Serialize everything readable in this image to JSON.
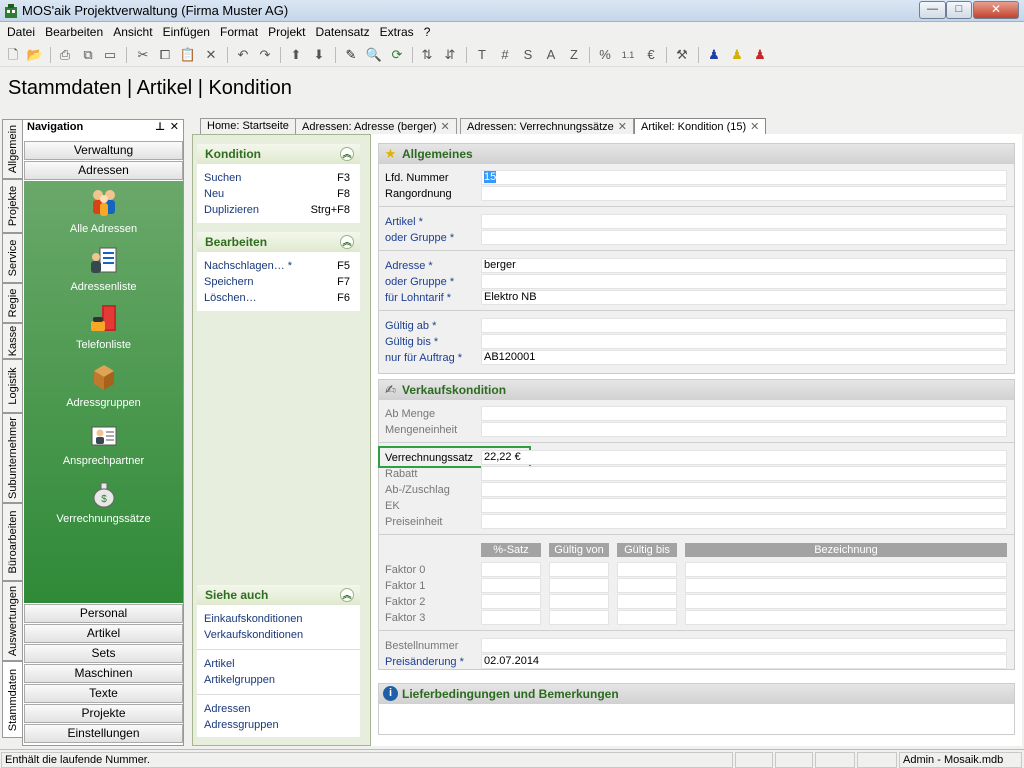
{
  "window": {
    "title": "MOS'aik Projektverwaltung (Firma Muster AG)",
    "min": "—",
    "max": "□",
    "close": "✕"
  },
  "menu": [
    "Datei",
    "Bearbeiten",
    "Ansicht",
    "Einfügen",
    "Format",
    "Projekt",
    "Datensatz",
    "Extras",
    "?"
  ],
  "page_title": "Stammdaten | Artikel | Kondition",
  "vertical_tabs": [
    "Allgemein",
    "Projekte",
    "Service",
    "Regie",
    "Kasse",
    "Logistik",
    "Subunternehmer",
    "Büroarbeiten",
    "Auswertungen",
    "Stammdaten"
  ],
  "navigation": {
    "title": "Navigation",
    "pin": "⊥",
    "close": "✕",
    "top_buttons": [
      "Verwaltung",
      "Adressen"
    ],
    "items": [
      "Alle Adressen",
      "Adressenliste",
      "Telefonliste",
      "Adressgruppen",
      "Ansprechpartner",
      "Verrechnungssätze"
    ],
    "bottom_buttons": [
      "Personal",
      "Artikel",
      "Sets",
      "Maschinen",
      "Texte",
      "Projekte",
      "Einstellungen"
    ]
  },
  "doc_tabs": [
    "Home: Startseite",
    "Adressen: Adresse (berger)",
    "Adressen: Verrechnungssätze",
    "Artikel: Kondition (15)"
  ],
  "tab_close": "✕",
  "task_panels": {
    "kondition": {
      "title": "Kondition",
      "rows": [
        {
          "label": "Suchen",
          "key": "F3"
        },
        {
          "label": "Neu",
          "key": "F8"
        },
        {
          "label": "Duplizieren",
          "key": "Strg+F8"
        }
      ]
    },
    "bearbeiten": {
      "title": "Bearbeiten",
      "rows": [
        {
          "label": "Nachschlagen… *",
          "key": "F5"
        },
        {
          "label": "Speichern",
          "key": "F7"
        },
        {
          "label": "Löschen…",
          "key": "F6"
        }
      ]
    },
    "siehe_auch": {
      "title": "Siehe auch",
      "groups": [
        [
          "Einkaufskonditionen",
          "Verkaufskonditionen"
        ],
        [
          "Artikel",
          "Artikelgruppen"
        ],
        [
          "Adressen",
          "Adressgruppen"
        ]
      ]
    },
    "chevron": "︽"
  },
  "allgemeines": {
    "title": "Allgemeines",
    "lfd_nummer": {
      "label": "Lfd. Nummer",
      "value": "15"
    },
    "rangordnung": {
      "label": "Rangordnung",
      "value": ""
    },
    "artikel": {
      "label": "Artikel *",
      "value": ""
    },
    "artikel_gruppe": {
      "label": "oder Gruppe *",
      "value": ""
    },
    "adresse": {
      "label": "Adresse *",
      "value": "berger"
    },
    "adresse_gruppe": {
      "label": "oder Gruppe *",
      "value": ""
    },
    "lohntarif": {
      "label": "für Lohntarif *",
      "value": "Elektro NB"
    },
    "gueltig_ab": {
      "label": "Gültig ab *",
      "value": ""
    },
    "gueltig_bis": {
      "label": "Gültig bis *",
      "value": ""
    },
    "auftrag": {
      "label": "nur für Auftrag *",
      "value": "AB120001"
    }
  },
  "verkaufskondition": {
    "title": "Verkaufskondition",
    "ab_menge": {
      "label": "Ab Menge",
      "value": ""
    },
    "mengeneinheit": {
      "label": "Mengeneinheit",
      "value": ""
    },
    "verrechnungssatz": {
      "label": "Verrechnungssatz",
      "value": "22,22 €"
    },
    "rabatt": {
      "label": "Rabatt",
      "value": ""
    },
    "zuschlag": {
      "label": "Ab-/Zuschlag",
      "value": ""
    },
    "ek": {
      "label": "EK",
      "value": ""
    },
    "preiseinheit": {
      "label": "Preiseinheit",
      "value": ""
    },
    "columns": [
      "%-Satz",
      "Gültig von",
      "Gültig bis",
      "Bezeichnung"
    ],
    "factors": [
      "Faktor 0",
      "Faktor 1",
      "Faktor 2",
      "Faktor 3"
    ],
    "bestellnummer": {
      "label": "Bestellnummer",
      "value": ""
    },
    "preisaenderung": {
      "label": "Preisänderung *",
      "value": "02.07.2014"
    }
  },
  "lieferbedingungen": {
    "title": "Lieferbedingungen und Bemerkungen"
  },
  "status": {
    "text": "Enthält die laufende Nummer.",
    "user": "Admin - Mosaik.mdb"
  },
  "colors": {
    "accent_green": "#2b6b1f",
    "nav_green": "#3f8f43",
    "link_blue": "#1c3e92",
    "highlight_border": "#2ea043"
  }
}
